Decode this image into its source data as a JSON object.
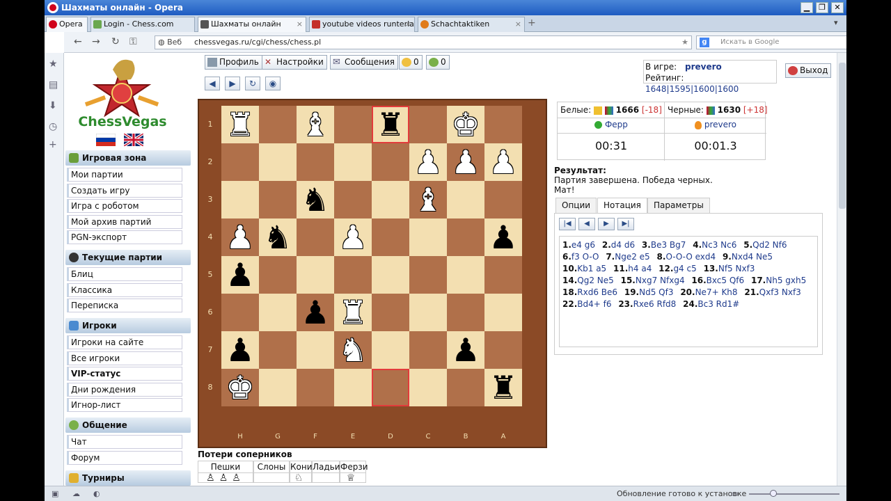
{
  "window": {
    "title": "Шахматы онлайн - Opera"
  },
  "tabs": [
    {
      "label": "Opera",
      "icon": "opera-icon"
    },
    {
      "label": "Login - Chess.com",
      "icon": "chesscom-icon"
    },
    {
      "label": "Шахматы онлайн",
      "icon": "chessvegas-icon",
      "active": true
    },
    {
      "label": "youtube videos runterla...",
      "icon": "youtube-icon"
    },
    {
      "label": "Schachtaktiken",
      "icon": "schach-icon"
    }
  ],
  "address": {
    "scheme_label": "Веб",
    "url": "chessvegas.ru/cgi/chess/chess.pl",
    "search_placeholder": "Искать в Google"
  },
  "status": {
    "text": "Обновление готово к установке"
  },
  "logo": {
    "text": "ChessVegas"
  },
  "toolbar": {
    "profile": "Профиль",
    "settings": "Настройки",
    "messages": "Сообщения",
    "coins": "0",
    "msgcount": "0",
    "exit": "Выход"
  },
  "ingame": {
    "label": "В игре:",
    "user": "prevero",
    "rating_label": "Рейтинг:",
    "ratings": "1648|1595|1600|1600"
  },
  "menu": {
    "game_zone": {
      "title": "Игровая зона",
      "items": [
        "Мои партии",
        "Создать игру",
        "Игра с роботом",
        "Мой архив партий",
        "PGN-экспорт"
      ]
    },
    "current": {
      "title": "Текущие партии",
      "items": [
        "Блиц",
        "Классика",
        "Переписка"
      ]
    },
    "players": {
      "title": "Игроки",
      "items": [
        "Игроки на сайте",
        "Все игроки",
        "VIP-статус",
        "Дни рождения",
        "Игнор-лист"
      ]
    },
    "comm": {
      "title": "Общение",
      "items": [
        "Чат",
        "Форум"
      ]
    },
    "tournaments": {
      "title": "Турниры"
    }
  },
  "board": {
    "files": [
      "H",
      "G",
      "F",
      "E",
      "D",
      "C",
      "B",
      "A"
    ],
    "ranks": [
      "1",
      "2",
      "3",
      "4",
      "5",
      "6",
      "7",
      "8"
    ],
    "pieces": [
      {
        "sq": "h1",
        "p": "R",
        "c": "w"
      },
      {
        "sq": "f1",
        "p": "B",
        "c": "w"
      },
      {
        "sq": "d1",
        "p": "R",
        "c": "b"
      },
      {
        "sq": "b1",
        "p": "K",
        "c": "w"
      },
      {
        "sq": "c2",
        "p": "P",
        "c": "w"
      },
      {
        "sq": "b2",
        "p": "P",
        "c": "w"
      },
      {
        "sq": "a2",
        "p": "P",
        "c": "w"
      },
      {
        "sq": "f3",
        "p": "N",
        "c": "b"
      },
      {
        "sq": "c3",
        "p": "B",
        "c": "w"
      },
      {
        "sq": "h4",
        "p": "P",
        "c": "w"
      },
      {
        "sq": "g4",
        "p": "N",
        "c": "b"
      },
      {
        "sq": "e4",
        "p": "P",
        "c": "w"
      },
      {
        "sq": "a4",
        "p": "P",
        "c": "b"
      },
      {
        "sq": "h5",
        "p": "P",
        "c": "b"
      },
      {
        "sq": "f6",
        "p": "P",
        "c": "b"
      },
      {
        "sq": "e6",
        "p": "R",
        "c": "w"
      },
      {
        "sq": "h7",
        "p": "P",
        "c": "b"
      },
      {
        "sq": "e7",
        "p": "N",
        "c": "w"
      },
      {
        "sq": "b7",
        "p": "P",
        "c": "b"
      },
      {
        "sq": "h8",
        "p": "K",
        "c": "w"
      },
      {
        "sq": "a8",
        "p": "R",
        "c": "b"
      }
    ],
    "highlight": [
      "d1",
      "d8"
    ]
  },
  "losses": {
    "title": "Потери соперников",
    "cols": [
      "Пешки",
      "Слоны",
      "Кони",
      "Ладьи",
      "Ферзи"
    ]
  },
  "players": {
    "white_label": "Белые:",
    "white_rating": "1666",
    "white_delta": "[-18]",
    "white_name": "Ферр",
    "white_time": "00:31",
    "black_label": "Черные:",
    "black_rating": "1630",
    "black_delta": "[+18]",
    "black_name": "prevero",
    "black_time": "00:01.3"
  },
  "result": {
    "label": "Результат:",
    "line1": "Партия завершена. Победа черных.",
    "line2": "Мат!"
  },
  "rtabs": [
    "Опции",
    "Нотация",
    "Параметры"
  ],
  "moves": [
    {
      "n": "1.",
      "m": "e4 g6"
    },
    {
      "n": "2.",
      "m": "d4 d6"
    },
    {
      "n": "3.",
      "m": "Be3 Bg7"
    },
    {
      "n": "4.",
      "m": "Nc3 Nc6"
    },
    {
      "n": "5.",
      "m": "Qd2 Nf6"
    },
    {
      "n": "6.",
      "m": "f3 O-O"
    },
    {
      "n": "7.",
      "m": "Nge2 e5"
    },
    {
      "n": "8.",
      "m": "O-O-O exd4"
    },
    {
      "n": "9.",
      "m": "Nxd4 Ne5"
    },
    {
      "n": "10.",
      "m": "Kb1 a5"
    },
    {
      "n": "11.",
      "m": "h4 a4"
    },
    {
      "n": "12.",
      "m": "g4 c5"
    },
    {
      "n": "13.",
      "m": "Nf5 Nxf3"
    },
    {
      "n": "14.",
      "m": "Qg2 Ne5"
    },
    {
      "n": "15.",
      "m": "Nxg7 Nfxg4"
    },
    {
      "n": "16.",
      "m": "Bxc5 Qf6"
    },
    {
      "n": "17.",
      "m": "Nh5 gxh5"
    },
    {
      "n": "18.",
      "m": "Rxd6 Be6"
    },
    {
      "n": "19.",
      "m": "Nd5 Qf3"
    },
    {
      "n": "20.",
      "m": "Ne7+ Kh8"
    },
    {
      "n": "21.",
      "m": "Qxf3 Nxf3"
    },
    {
      "n": "22.",
      "m": "Bd4+ f6"
    },
    {
      "n": "23.",
      "m": "Rxe6 Rfd8"
    },
    {
      "n": "24.",
      "m": "Bc3 Rd1#"
    }
  ],
  "colors": {
    "light": "#f3dfb1",
    "dark": "#b0704a",
    "frame": "#8b4a26",
    "highlight": "#e23b3b"
  }
}
